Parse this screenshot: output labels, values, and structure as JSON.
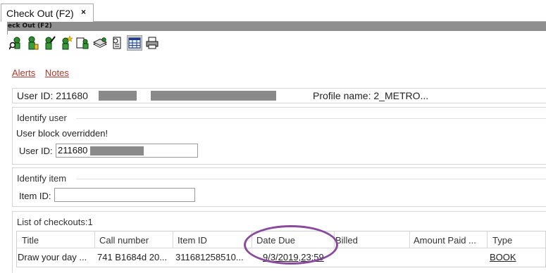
{
  "tab": {
    "title": "Check Out (F2)",
    "close": "×"
  },
  "window": {
    "title": "eck Out (F2)"
  },
  "toolbar": {
    "icons": [
      "find-user-icon",
      "user-add-icon",
      "user-edit-icon",
      "user-new-icon",
      "checkout-icon",
      "books-icon",
      "receipt-icon",
      "calendar-icon",
      "print-icon"
    ]
  },
  "links": {
    "alerts": "Alerts",
    "notes": "Notes"
  },
  "userbar": {
    "user_id": "User ID: 211680",
    "profile": "Profile name: 2_METRO..."
  },
  "identify_user": {
    "legend": "Identify user",
    "message": "User block overridden!",
    "label": "User ID:",
    "value": "211680"
  },
  "identify_item": {
    "legend": "Identify item",
    "label": "Item ID:",
    "value": ""
  },
  "checkouts": {
    "legend": "List of checkouts:1",
    "columns": [
      "Title",
      "Call number",
      "Item ID",
      "Date Due",
      "Billed",
      "Amount Paid ...",
      "Type"
    ],
    "rows": [
      {
        "title": "Draw your day ...",
        "call_number": "741 B1684d 20...",
        "item_id": "311681258510...",
        "date_due": "9/3/2019,23:59",
        "billed": "",
        "amount_paid": "",
        "type": "BOOK"
      }
    ]
  },
  "colors": {
    "link": "#b03a2e",
    "annotation_circle": "#8a4a9e",
    "title_strip": "#8f8f8f"
  }
}
